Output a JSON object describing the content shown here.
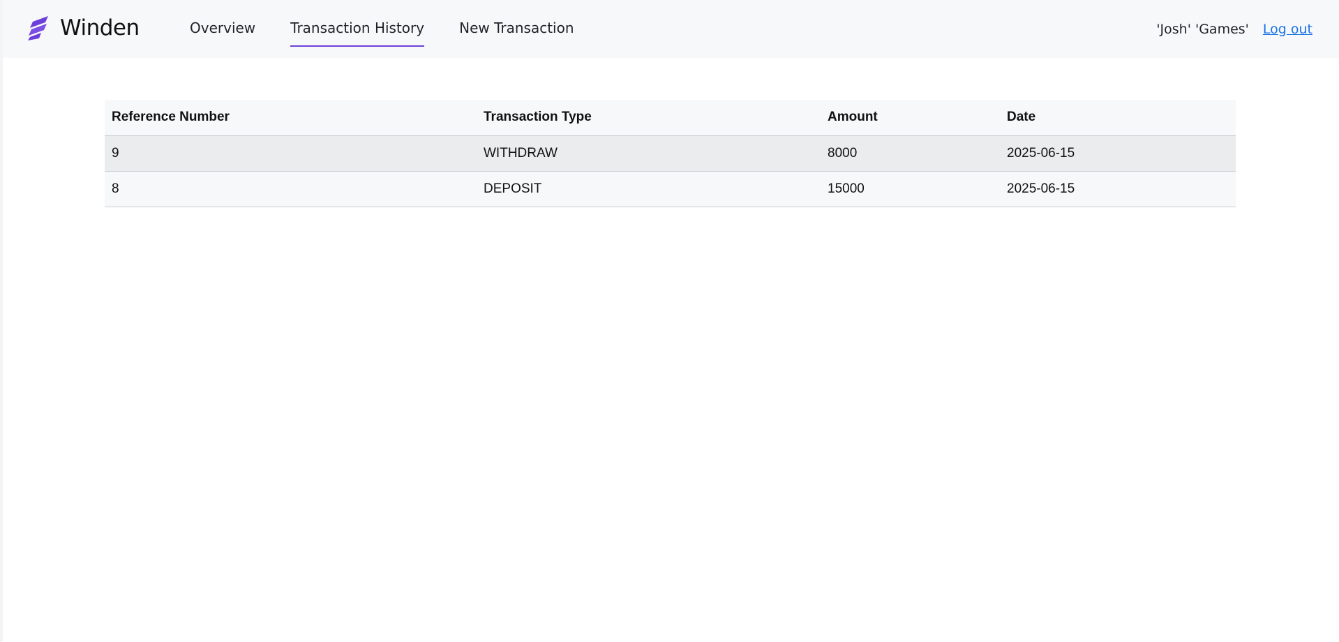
{
  "brand": {
    "name": "Winden",
    "logo_icon": "winden-logo-icon",
    "accent_color": "#6d3fd8"
  },
  "nav": {
    "items": [
      {
        "label": "Overview",
        "active": false
      },
      {
        "label": "Transaction History",
        "active": true
      },
      {
        "label": "New Transaction",
        "active": false
      }
    ]
  },
  "user": {
    "display_name": "'Josh' 'Games'",
    "logout_label": "Log out"
  },
  "transactions": {
    "columns": [
      "Reference Number",
      "Transaction Type",
      "Amount",
      "Date"
    ],
    "rows": [
      {
        "reference": "9",
        "type": "WITHDRAW",
        "amount": "8000",
        "date": "2025-06-15"
      },
      {
        "reference": "8",
        "type": "DEPOSIT",
        "amount": "15000",
        "date": "2025-06-15"
      }
    ]
  }
}
